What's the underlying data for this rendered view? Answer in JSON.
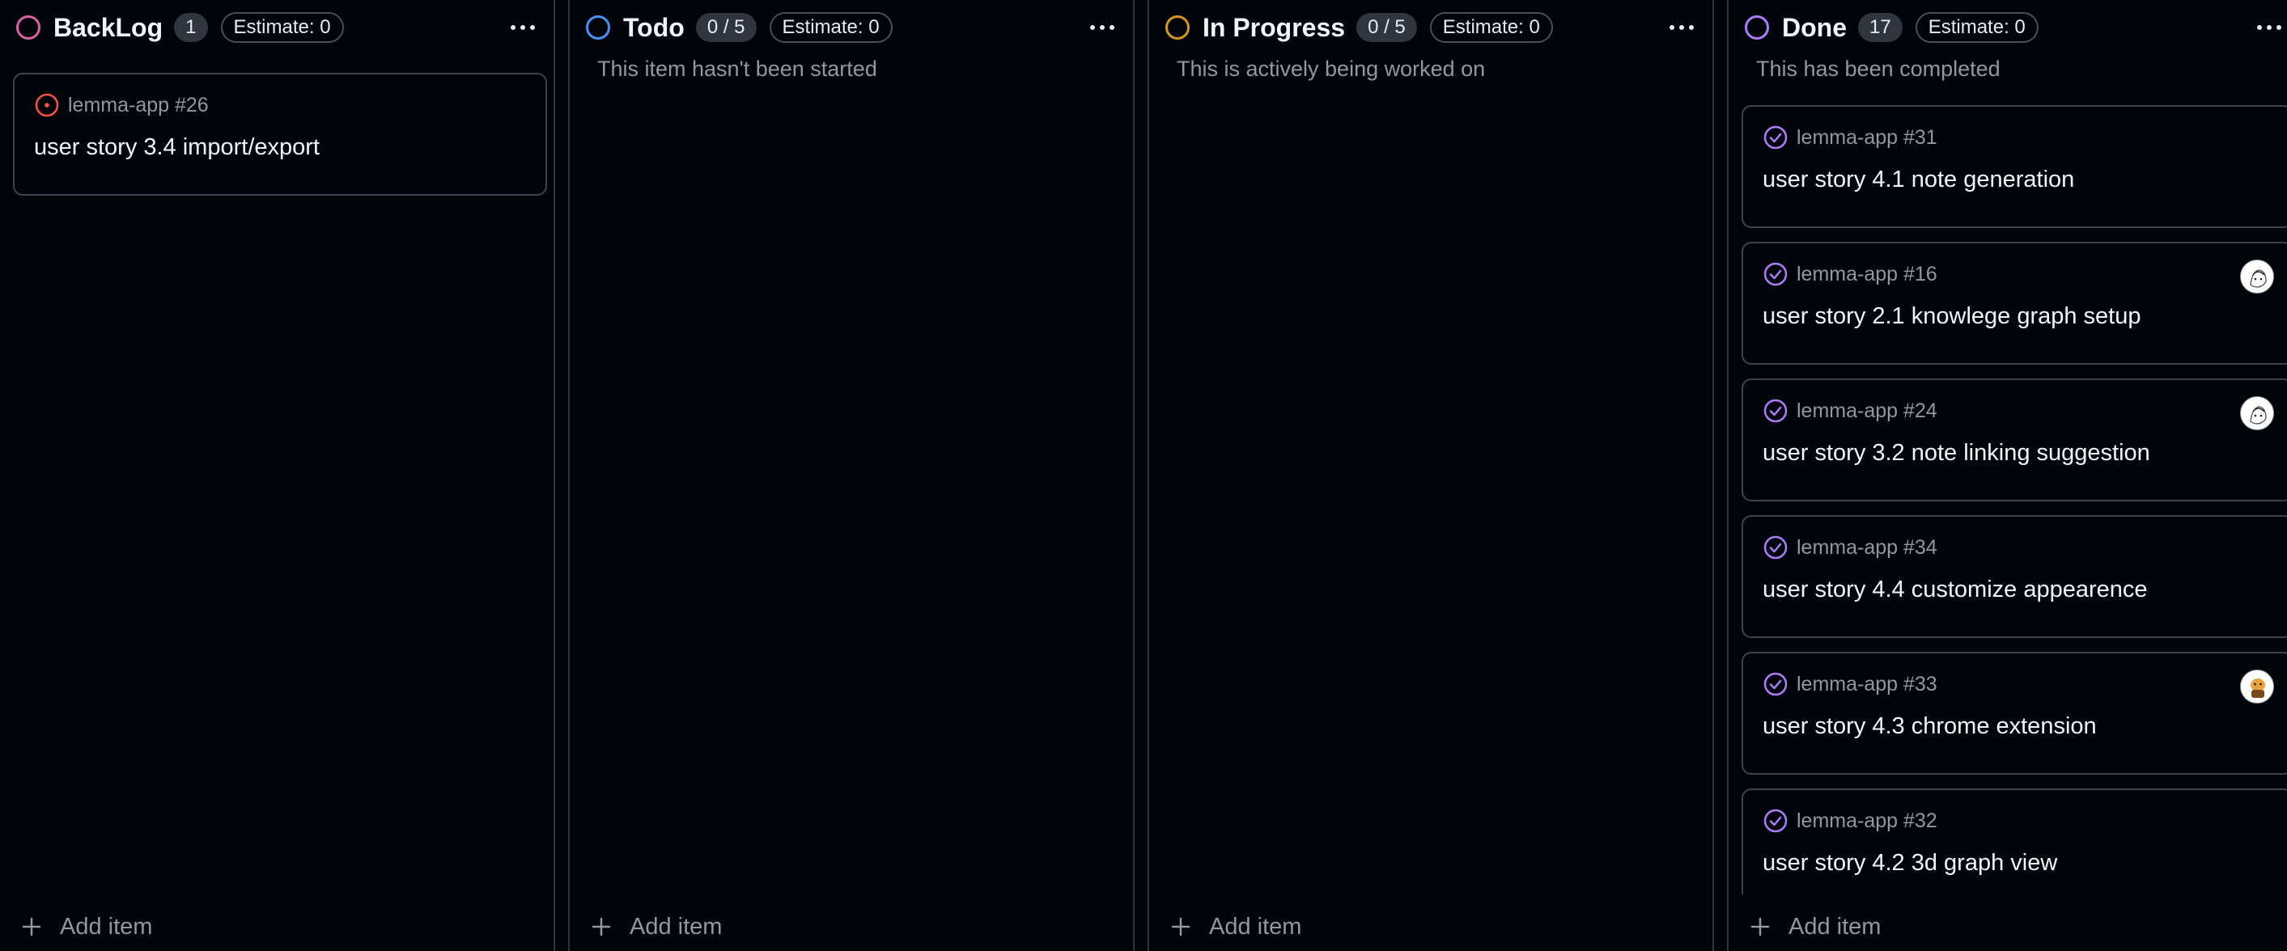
{
  "colors": {
    "backlog": "#db61a2",
    "todo": "#4493f8",
    "in_progress": "#d29922",
    "done": "#ab7df8",
    "open_issue": "#f85149",
    "closed_issue": "#ab7df8"
  },
  "columns": [
    {
      "title": "BackLog",
      "count": "1",
      "estimate": "Estimate: 0",
      "description": "",
      "add_label": "Add item",
      "cards": [
        {
          "repo": "lemma-app #26",
          "title": "user story 3.4 import/export",
          "icon": "open-issue-icon",
          "avatar": false
        }
      ]
    },
    {
      "title": "Todo",
      "count": "0 / 5",
      "estimate": "Estimate: 0",
      "description": "This item hasn't been started",
      "add_label": "Add item",
      "cards": []
    },
    {
      "title": "In Progress",
      "count": "0 / 5",
      "estimate": "Estimate: 0",
      "description": "This is actively being worked on",
      "add_label": "Add item",
      "cards": []
    },
    {
      "title": "Done",
      "count": "17",
      "estimate": "Estimate: 0",
      "description": "This has been completed",
      "add_label": "Add item",
      "cards": [
        {
          "repo": "lemma-app #31",
          "title": "user story 4.1 note generation",
          "icon": "closed-issue-icon",
          "avatar": false
        },
        {
          "repo": "lemma-app #16",
          "title": "user story 2.1 knowlege graph setup",
          "icon": "closed-issue-icon",
          "avatar": true
        },
        {
          "repo": "lemma-app #24",
          "title": "user story 3.2 note linking suggestion",
          "icon": "closed-issue-icon",
          "avatar": true
        },
        {
          "repo": "lemma-app #34",
          "title": "user story 4.4 customize appearence",
          "icon": "closed-issue-icon",
          "avatar": false
        },
        {
          "repo": "lemma-app #33",
          "title": "user story 4.3 chrome extension",
          "icon": "closed-issue-icon",
          "avatar": true
        },
        {
          "repo": "lemma-app #32",
          "title": "user story 4.2 3d graph view",
          "icon": "closed-issue-icon",
          "avatar": false
        }
      ]
    }
  ]
}
